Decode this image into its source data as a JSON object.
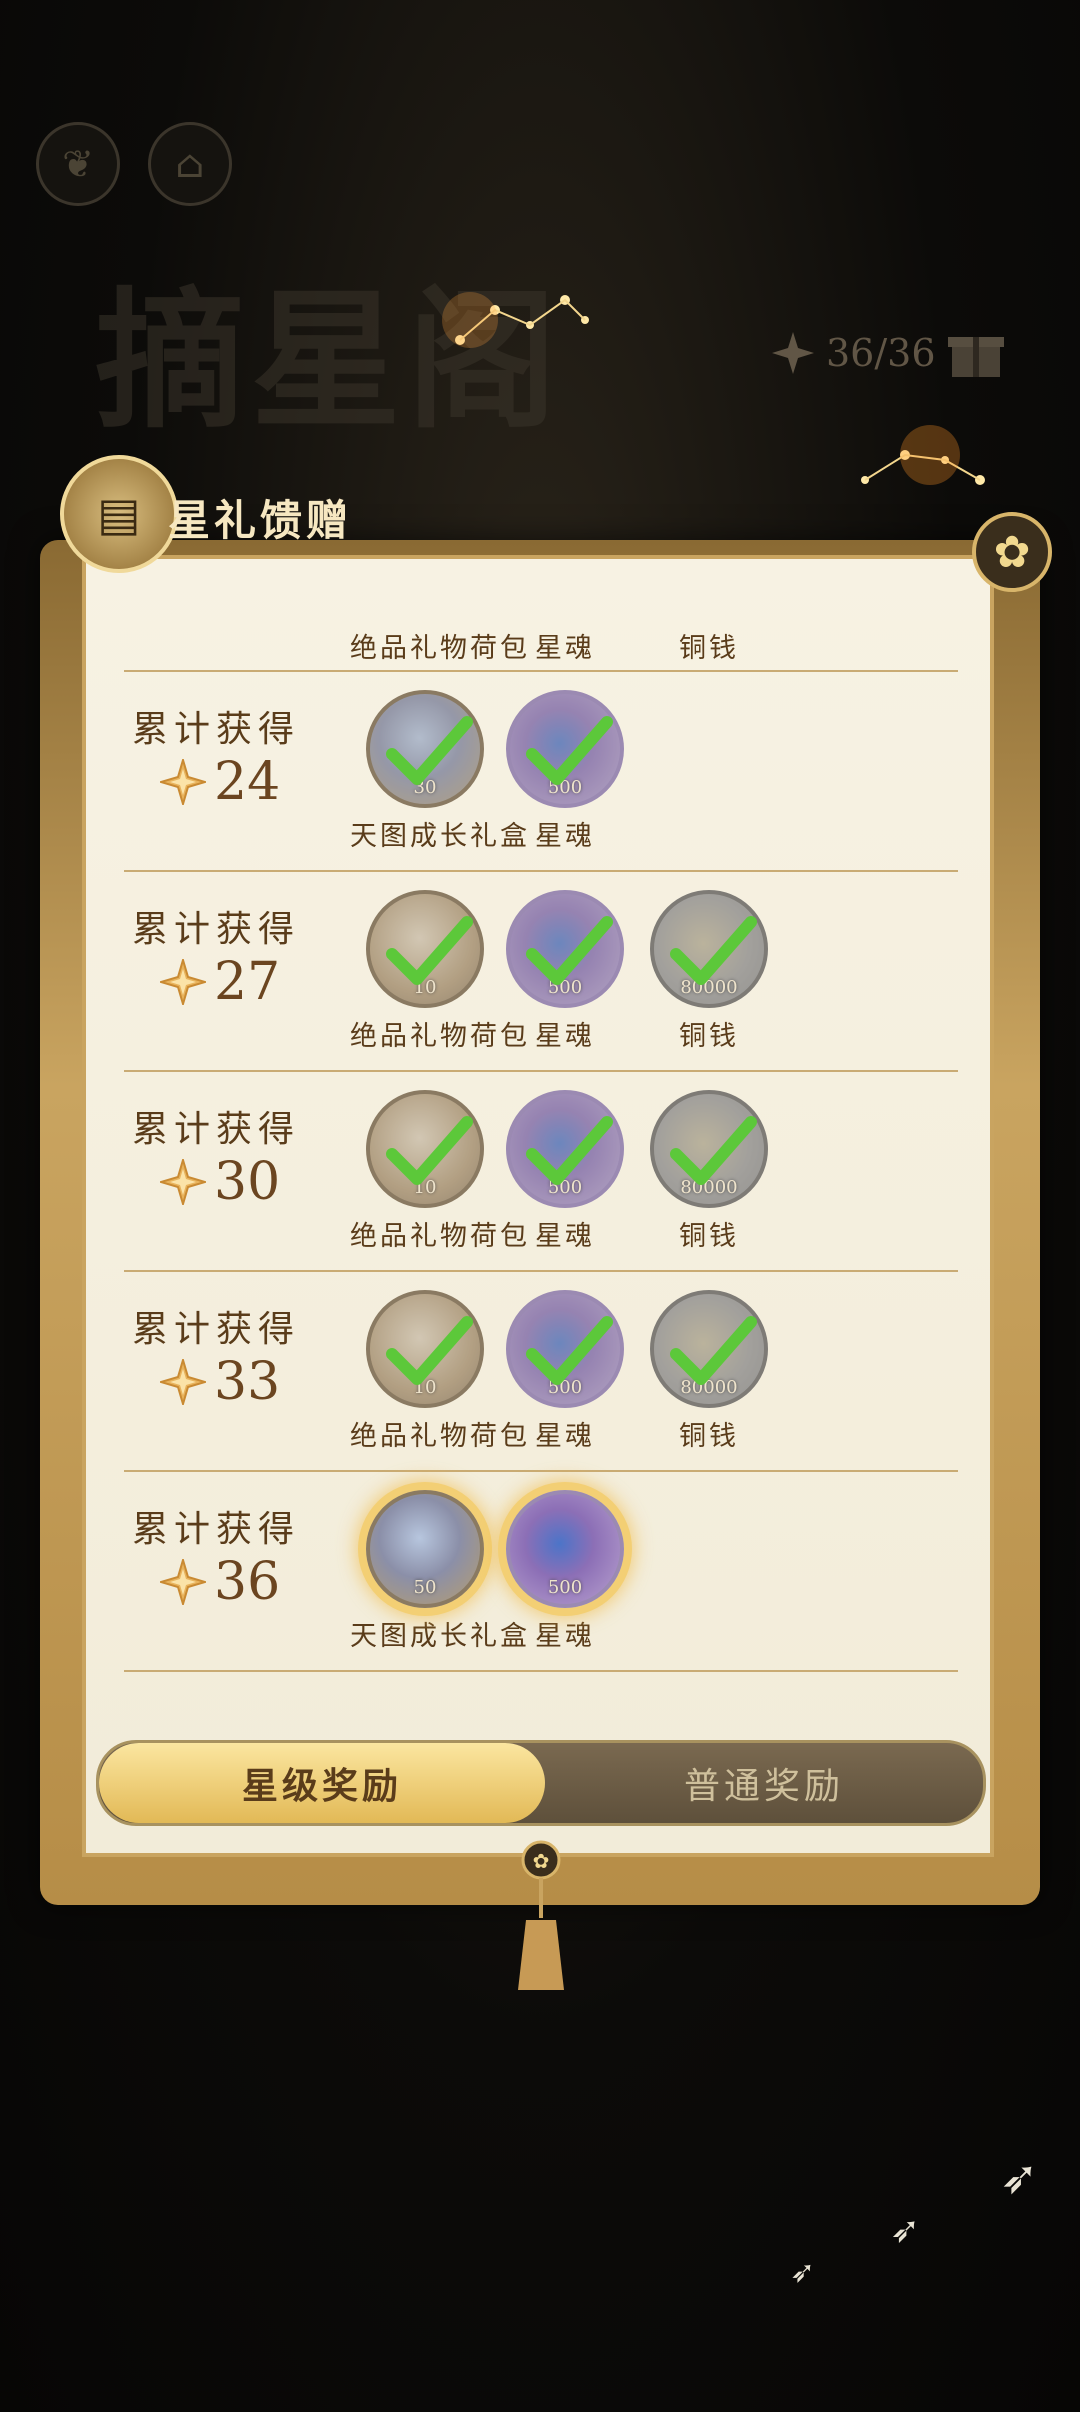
{
  "background": {
    "title": "摘星阁",
    "star_count": "36/36"
  },
  "header": {
    "title": "星礼馈赠"
  },
  "partial_row": {
    "rewards": [
      "绝品礼物荷包",
      "星魂",
      "铜钱"
    ]
  },
  "rows": [
    {
      "label": "累计获得",
      "stars": "24",
      "rewards": [
        {
          "name": "天图成长礼盒",
          "qty": "30",
          "type": "gift",
          "claimed": true
        },
        {
          "name": "星魂",
          "qty": "500",
          "type": "soul",
          "claimed": true
        }
      ]
    },
    {
      "label": "累计获得",
      "stars": "27",
      "rewards": [
        {
          "name": "绝品礼物荷包",
          "qty": "10",
          "type": "pouch",
          "claimed": true
        },
        {
          "name": "星魂",
          "qty": "500",
          "type": "soul",
          "claimed": true
        },
        {
          "name": "铜钱",
          "qty": "80000",
          "type": "copper",
          "claimed": true
        }
      ]
    },
    {
      "label": "累计获得",
      "stars": "30",
      "rewards": [
        {
          "name": "绝品礼物荷包",
          "qty": "10",
          "type": "pouch",
          "claimed": true
        },
        {
          "name": "星魂",
          "qty": "500",
          "type": "soul",
          "claimed": true
        },
        {
          "name": "铜钱",
          "qty": "80000",
          "type": "copper",
          "claimed": true
        }
      ]
    },
    {
      "label": "累计获得",
      "stars": "33",
      "rewards": [
        {
          "name": "绝品礼物荷包",
          "qty": "10",
          "type": "pouch",
          "claimed": true
        },
        {
          "name": "星魂",
          "qty": "500",
          "type": "soul",
          "claimed": true
        },
        {
          "name": "铜钱",
          "qty": "80000",
          "type": "copper",
          "claimed": true
        }
      ]
    },
    {
      "label": "累计获得",
      "stars": "36",
      "rewards": [
        {
          "name": "天图成长礼盒",
          "qty": "50",
          "type": "gift",
          "claimed": false
        },
        {
          "name": "星魂",
          "qty": "500",
          "type": "soul",
          "claimed": false
        }
      ]
    }
  ],
  "tabs": [
    {
      "label": "星级奖励",
      "active": true
    },
    {
      "label": "普通奖励",
      "active": false
    }
  ],
  "colors": {
    "accent_gold": "#e2b956",
    "check_green": "#5cc83a",
    "text_brown": "#5a3c1a"
  }
}
